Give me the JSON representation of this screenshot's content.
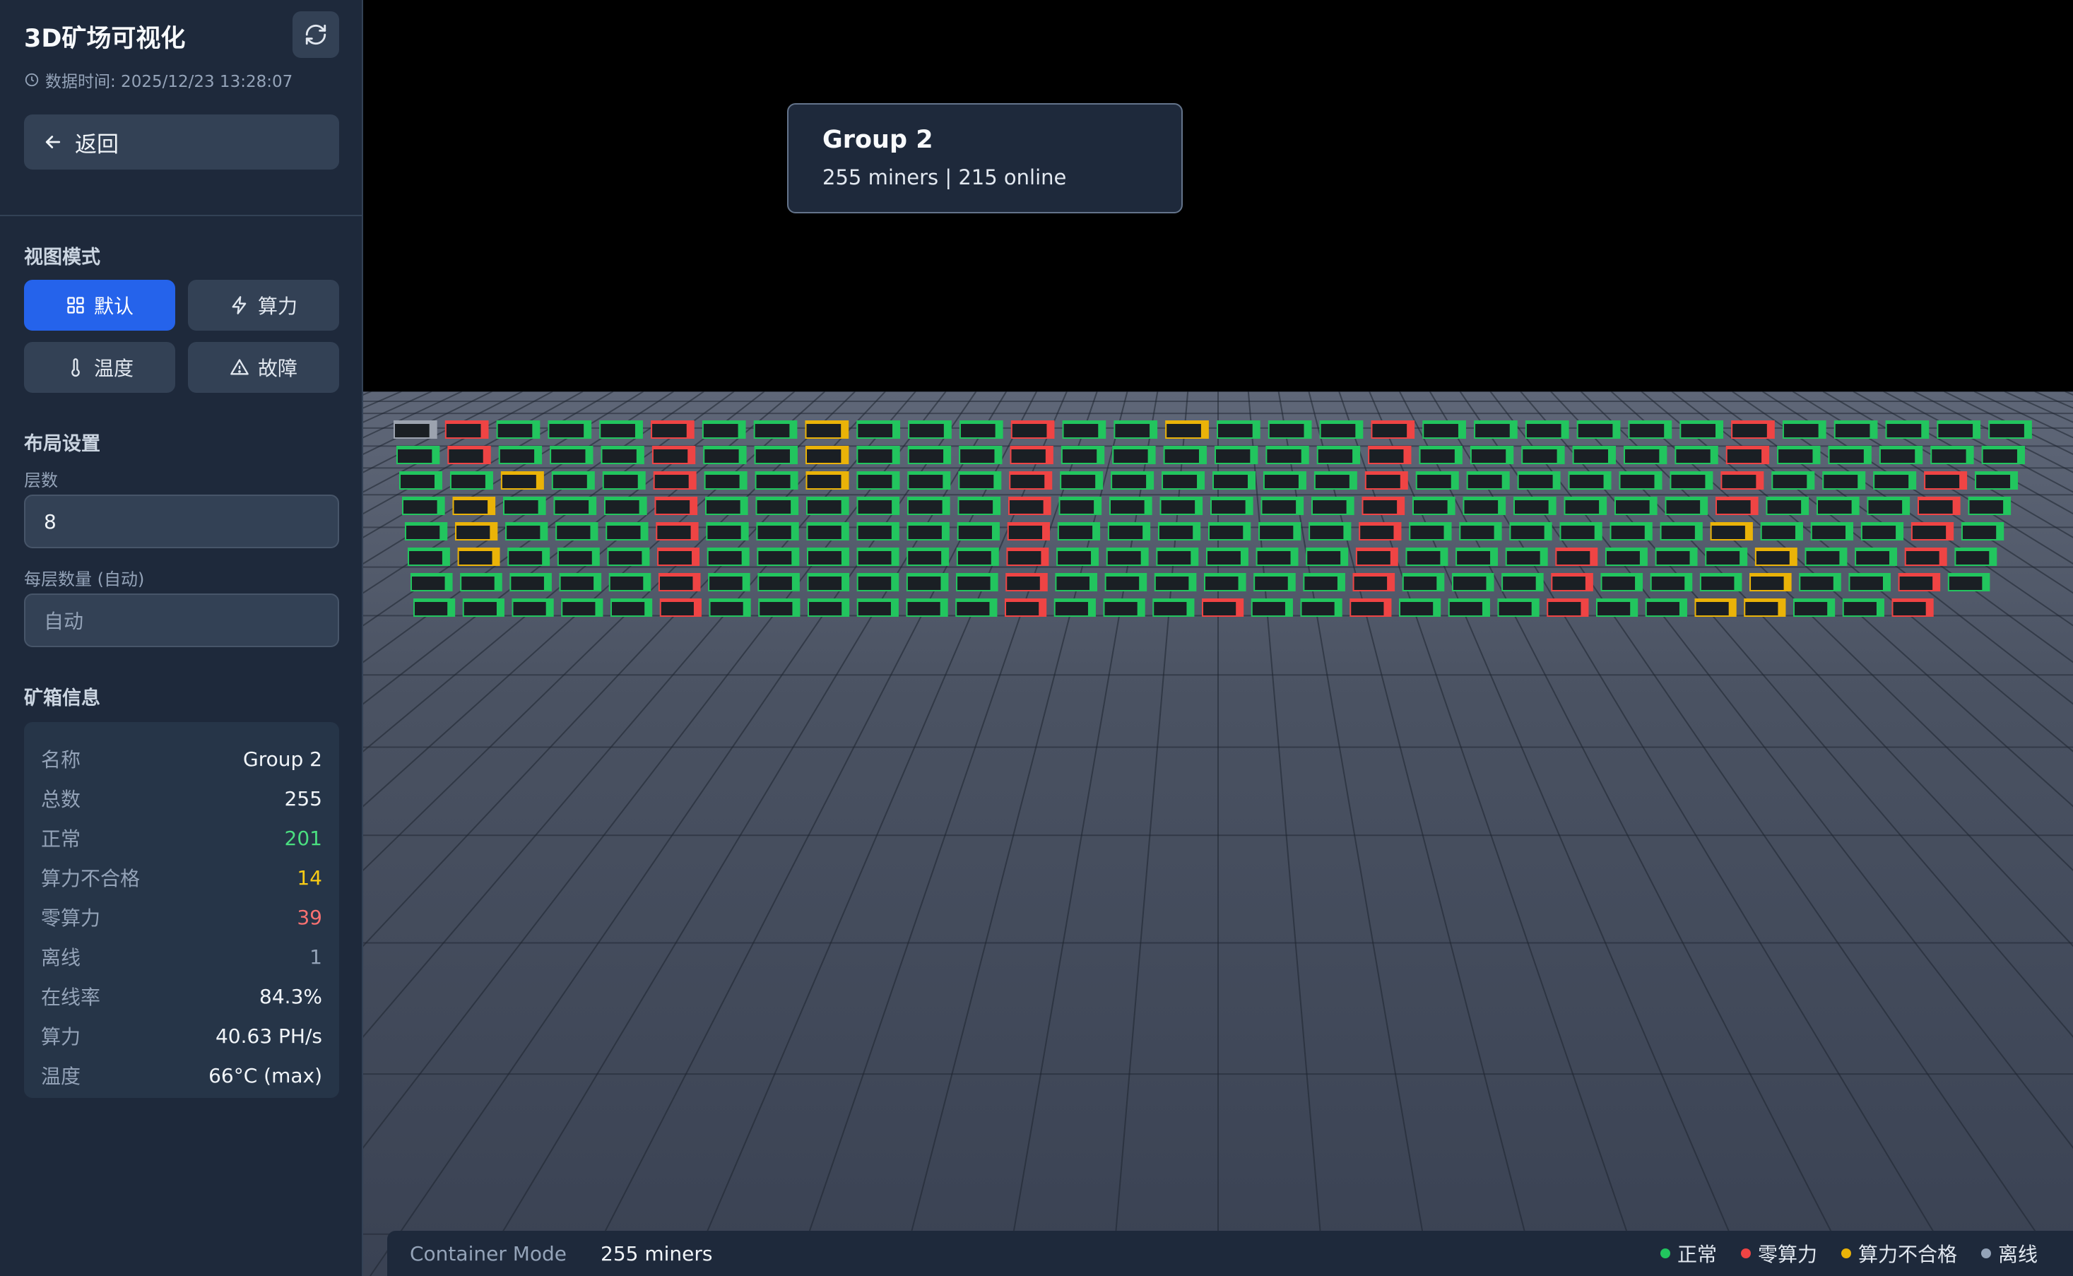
{
  "sidebar": {
    "title": "3D矿场可视化",
    "data_time": "数据时间: 2025/12/23 13:28:07",
    "back_label": "返回",
    "view_mode": {
      "label": "视图模式",
      "buttons": [
        {
          "label": "默认",
          "icon": "grid-icon",
          "active": true
        },
        {
          "label": "算力",
          "icon": "bolt-icon",
          "active": false
        },
        {
          "label": "温度",
          "icon": "thermometer-icon",
          "active": false
        },
        {
          "label": "故障",
          "icon": "warning-icon",
          "active": false
        }
      ]
    },
    "layout": {
      "label": "布局设置",
      "layers_label": "层数",
      "layers_value": "8",
      "per_layer_label": "每层数量 (自动)",
      "per_layer_placeholder": "自动"
    },
    "info": {
      "label": "矿箱信息",
      "rows": [
        {
          "key": "名称",
          "value": "Group 2",
          "color": "#f1f5f9"
        },
        {
          "key": "总数",
          "value": "255",
          "color": "#f1f5f9"
        },
        {
          "key": "正常",
          "value": "201",
          "color": "#4ade80"
        },
        {
          "key": "算力不合格",
          "value": "14",
          "color": "#facc15"
        },
        {
          "key": "零算力",
          "value": "39",
          "color": "#f87171"
        },
        {
          "key": "离线",
          "value": "1",
          "color": "#94a3b8"
        },
        {
          "key": "在线率",
          "value": "84.3%",
          "color": "#f1f5f9"
        },
        {
          "key": "算力",
          "value": "40.63 PH/s",
          "color": "#f1f5f9"
        },
        {
          "key": "温度",
          "value": "66°C (max)",
          "color": "#f1f5f9"
        }
      ]
    }
  },
  "tooltip": {
    "title": "Group 2",
    "subtitle": "255 miners | 215 online"
  },
  "bottom_bar": {
    "mode": "Container Mode",
    "count": "255 miners",
    "legend": [
      {
        "label": "正常",
        "color": "#22c55e"
      },
      {
        "label": "零算力",
        "color": "#ef4444"
      },
      {
        "label": "算力不合格",
        "color": "#eab308"
      },
      {
        "label": "离线",
        "color": "#94a3b8"
      }
    ]
  },
  "colors": {
    "normal": "#22c55e",
    "zero_hash": "#ef4444",
    "under_hash": "#eab308",
    "offline": "#9ca3af"
  },
  "miner_grid": {
    "rows": 8,
    "cols": 32,
    "red_columns": [
      5,
      12,
      19
    ],
    "yellow_cells": [
      [
        0,
        8
      ],
      [
        0,
        15
      ],
      [
        1,
        8
      ],
      [
        2,
        2
      ],
      [
        2,
        8
      ],
      [
        3,
        1
      ],
      [
        4,
        1
      ],
      [
        5,
        1
      ],
      [
        7,
        26
      ],
      [
        5,
        27
      ],
      [
        6,
        27
      ],
      [
        7,
        27
      ],
      [
        4,
        26
      ]
    ],
    "red_cells": [
      [
        0,
        1
      ],
      [
        1,
        1
      ],
      [
        0,
        26
      ],
      [
        1,
        26
      ],
      [
        2,
        26
      ],
      [
        3,
        26
      ],
      [
        2,
        30
      ],
      [
        3,
        30
      ],
      [
        4,
        30
      ],
      [
        5,
        30
      ],
      [
        6,
        30
      ],
      [
        7,
        30
      ],
      [
        5,
        23
      ],
      [
        6,
        23
      ],
      [
        7,
        23
      ],
      [
        7,
        16
      ]
    ],
    "offline_cells": [
      [
        0,
        0
      ]
    ]
  }
}
